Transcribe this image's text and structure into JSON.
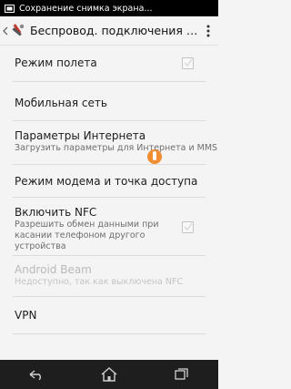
{
  "status_bar": {
    "notification_text": "Сохранение снимка экрана..."
  },
  "action_bar": {
    "title": "Беспровод. подключения и..."
  },
  "settings": [
    {
      "label": "Режим полета"
    },
    {
      "label": "Мобильная сеть"
    },
    {
      "label": "Параметры Интернета",
      "sub": "Загрузить параметры для Интернета и MMS"
    },
    {
      "label": "Режим модема и точка доступа"
    },
    {
      "label": "Включить NFC",
      "sub": "Разрешить обмен данными при касании телефоном другого устройства"
    },
    {
      "label": "Android Beam",
      "sub": "Недоступно, так как выключена NFC"
    },
    {
      "label": "VPN"
    }
  ],
  "icons": {
    "screenshot": "screenshot-icon",
    "back": "back-icon",
    "app": "settings-tools-icon",
    "overflow": "overflow-menu-icon",
    "nav_back": "nav-back-icon",
    "nav_home": "nav-home-icon",
    "nav_recent": "nav-recent-apps-icon"
  },
  "colors": {
    "background": "#f4f4f4",
    "status_bar": "#000000",
    "nav_bar": "#1e1e1e",
    "accent": "#f07a10"
  }
}
